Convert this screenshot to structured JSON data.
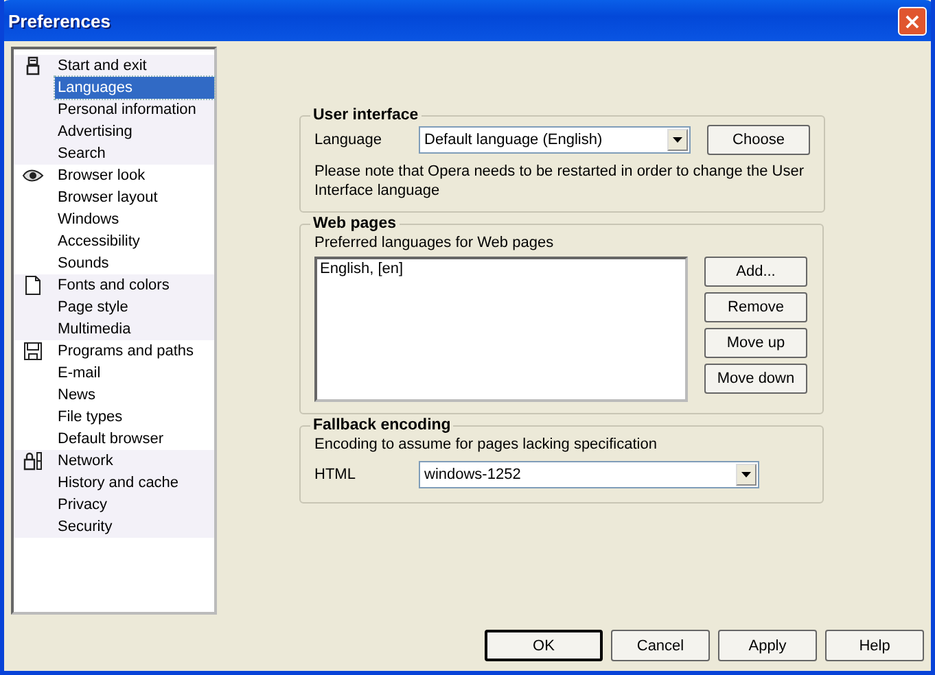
{
  "window": {
    "title": "Preferences",
    "close": "×"
  },
  "sidebar": {
    "groups": [
      {
        "items": [
          {
            "label": "Start and exit",
            "selected": false
          },
          {
            "label": "Languages",
            "selected": true
          },
          {
            "label": "Personal information",
            "selected": false
          },
          {
            "label": "Advertising",
            "selected": false
          },
          {
            "label": "Search",
            "selected": false
          }
        ]
      },
      {
        "items": [
          {
            "label": "Browser look",
            "selected": false
          },
          {
            "label": "Browser layout",
            "selected": false
          },
          {
            "label": "Windows",
            "selected": false
          },
          {
            "label": "Accessibility",
            "selected": false
          },
          {
            "label": "Sounds",
            "selected": false
          }
        ]
      },
      {
        "items": [
          {
            "label": "Fonts and colors",
            "selected": false
          },
          {
            "label": "Page style",
            "selected": false
          },
          {
            "label": "Multimedia",
            "selected": false
          }
        ]
      },
      {
        "items": [
          {
            "label": "Programs and paths",
            "selected": false
          },
          {
            "label": "E-mail",
            "selected": false
          },
          {
            "label": "News",
            "selected": false
          },
          {
            "label": "File types",
            "selected": false
          },
          {
            "label": "Default browser",
            "selected": false
          }
        ]
      },
      {
        "items": [
          {
            "label": "Network",
            "selected": false
          },
          {
            "label": "History and cache",
            "selected": false
          },
          {
            "label": "Privacy",
            "selected": false
          },
          {
            "label": "Security",
            "selected": false
          }
        ]
      }
    ]
  },
  "user_interface": {
    "title": "User interface",
    "language_label": "Language",
    "language_value": "Default language (English)",
    "choose_button": "Choose",
    "note": "Please note that Opera needs to be restarted in order to change the User Interface language"
  },
  "web_pages": {
    "title": "Web pages",
    "list_label": "Preferred languages for Web pages",
    "languages": [
      "English, [en]"
    ],
    "buttons": [
      "Add...",
      "Remove",
      "Move up",
      "Move down"
    ]
  },
  "fallback_encoding": {
    "title": "Fallback encoding",
    "description": "Encoding to assume for pages lacking specification",
    "html_label": "HTML",
    "html_value": "windows-1252"
  },
  "buttons": [
    "OK",
    "Cancel",
    "Apply",
    "Help"
  ]
}
